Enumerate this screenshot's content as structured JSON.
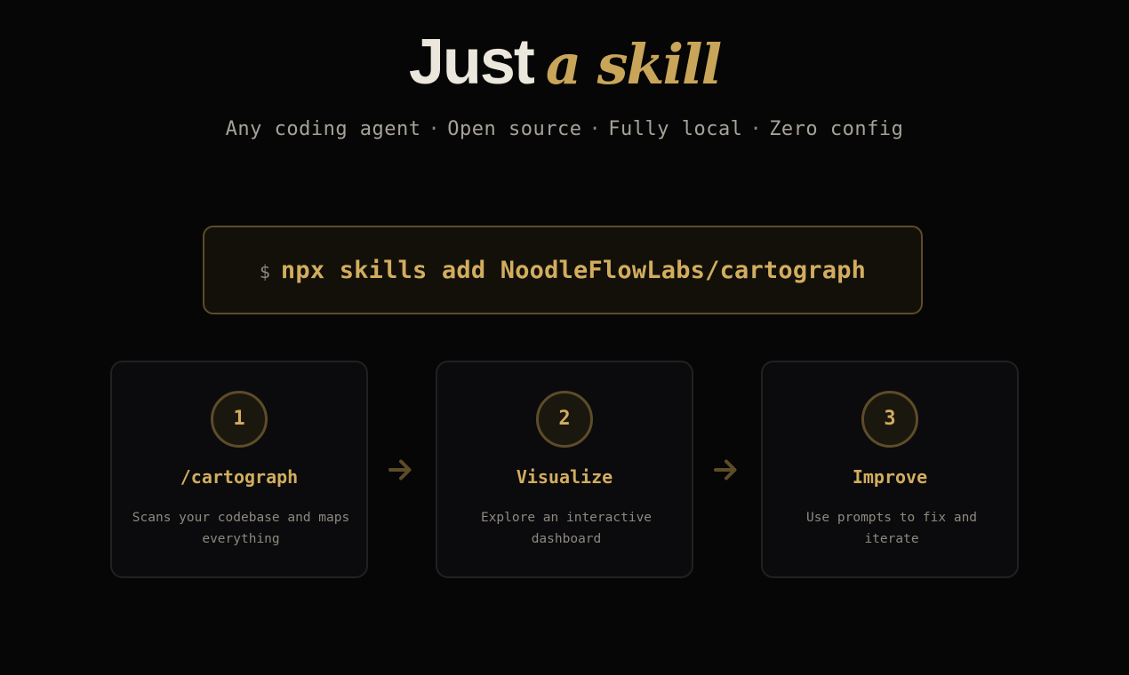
{
  "headline": {
    "plain": "Just",
    "fancy": "a skill"
  },
  "tagline": {
    "items": [
      "Any coding agent",
      "Open source",
      "Fully local",
      "Zero config"
    ],
    "separator": "·"
  },
  "command": {
    "prompt": "$",
    "text": "npx skills add NoodleFlowLabs/cartograph"
  },
  "steps": [
    {
      "number": "1",
      "title": "/cartograph",
      "description": "Scans your codebase and maps everything"
    },
    {
      "number": "2",
      "title": "Visualize",
      "description": "Explore an interactive dashboard"
    },
    {
      "number": "3",
      "title": "Improve",
      "description": "Use prompts to fix and iterate"
    }
  ],
  "icons": {
    "step_arrow": "arrow-right-icon"
  },
  "colors": {
    "background": "#060606",
    "accent": "#d2ad5f",
    "accent_dim": "#5e4c28",
    "text_primary": "#ece7dd",
    "text_muted": "#8d897f",
    "card_background": "#0b0b0d",
    "card_border": "#212124"
  }
}
